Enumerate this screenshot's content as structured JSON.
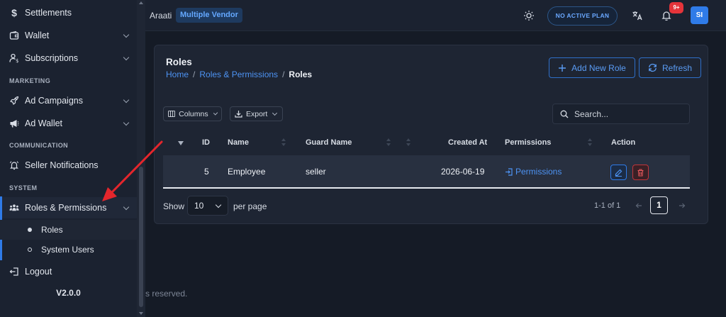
{
  "sidebar": {
    "items": [
      {
        "label": "Settlements"
      },
      {
        "label": "Wallet"
      },
      {
        "label": "Subscriptions"
      },
      {
        "label": "Ad Campaigns"
      },
      {
        "label": "Ad Wallet"
      },
      {
        "label": "Seller Notifications"
      },
      {
        "label": "Roles & Permissions"
      },
      {
        "label": "Logout"
      }
    ],
    "sections": [
      "MARKETING",
      "COMMUNICATION",
      "SYSTEM"
    ],
    "sub_items": [
      {
        "label": "Roles",
        "active": true
      },
      {
        "label": "System Users",
        "active": false
      }
    ],
    "version": "V2.0.0"
  },
  "header": {
    "brand": "Araati",
    "vendor_badge": "Multiple Vendor",
    "plan": "NO ACTIVE PLAN",
    "notification_count": "9+",
    "avatar_initials": "SI",
    "icons": [
      "sun-icon",
      "translate-icon",
      "bell-icon"
    ]
  },
  "page": {
    "title": "Roles",
    "breadcrumb": [
      "Home",
      "Roles & Permissions",
      "Roles"
    ],
    "breadcrumb_sep": "/",
    "add_button": "Add New Role",
    "refresh_button": "Refresh"
  },
  "toolbar": {
    "columns_label": "Columns",
    "export_label": "Export",
    "search_placeholder": "Search..."
  },
  "table": {
    "headers": [
      "ID",
      "Name",
      "Guard Name",
      "Created At",
      "Permissions",
      "Action"
    ],
    "rows": [
      {
        "id": "5",
        "name": "Employee",
        "guard": "seller",
        "created_at": "2026-06-19",
        "permissions": "Permissions"
      }
    ]
  },
  "pagination": {
    "show_label": "Show",
    "per_page_value": "10",
    "per_page_label": "per page",
    "range_text": "1-1 of 1",
    "current_page": "1"
  },
  "footer": {
    "text": "s reserved."
  },
  "colors": {
    "accent": "#2f7be8",
    "danger": "#e5343a",
    "background": "#151b26",
    "sidebar": "#1b2230",
    "card": "#1e2533"
  }
}
